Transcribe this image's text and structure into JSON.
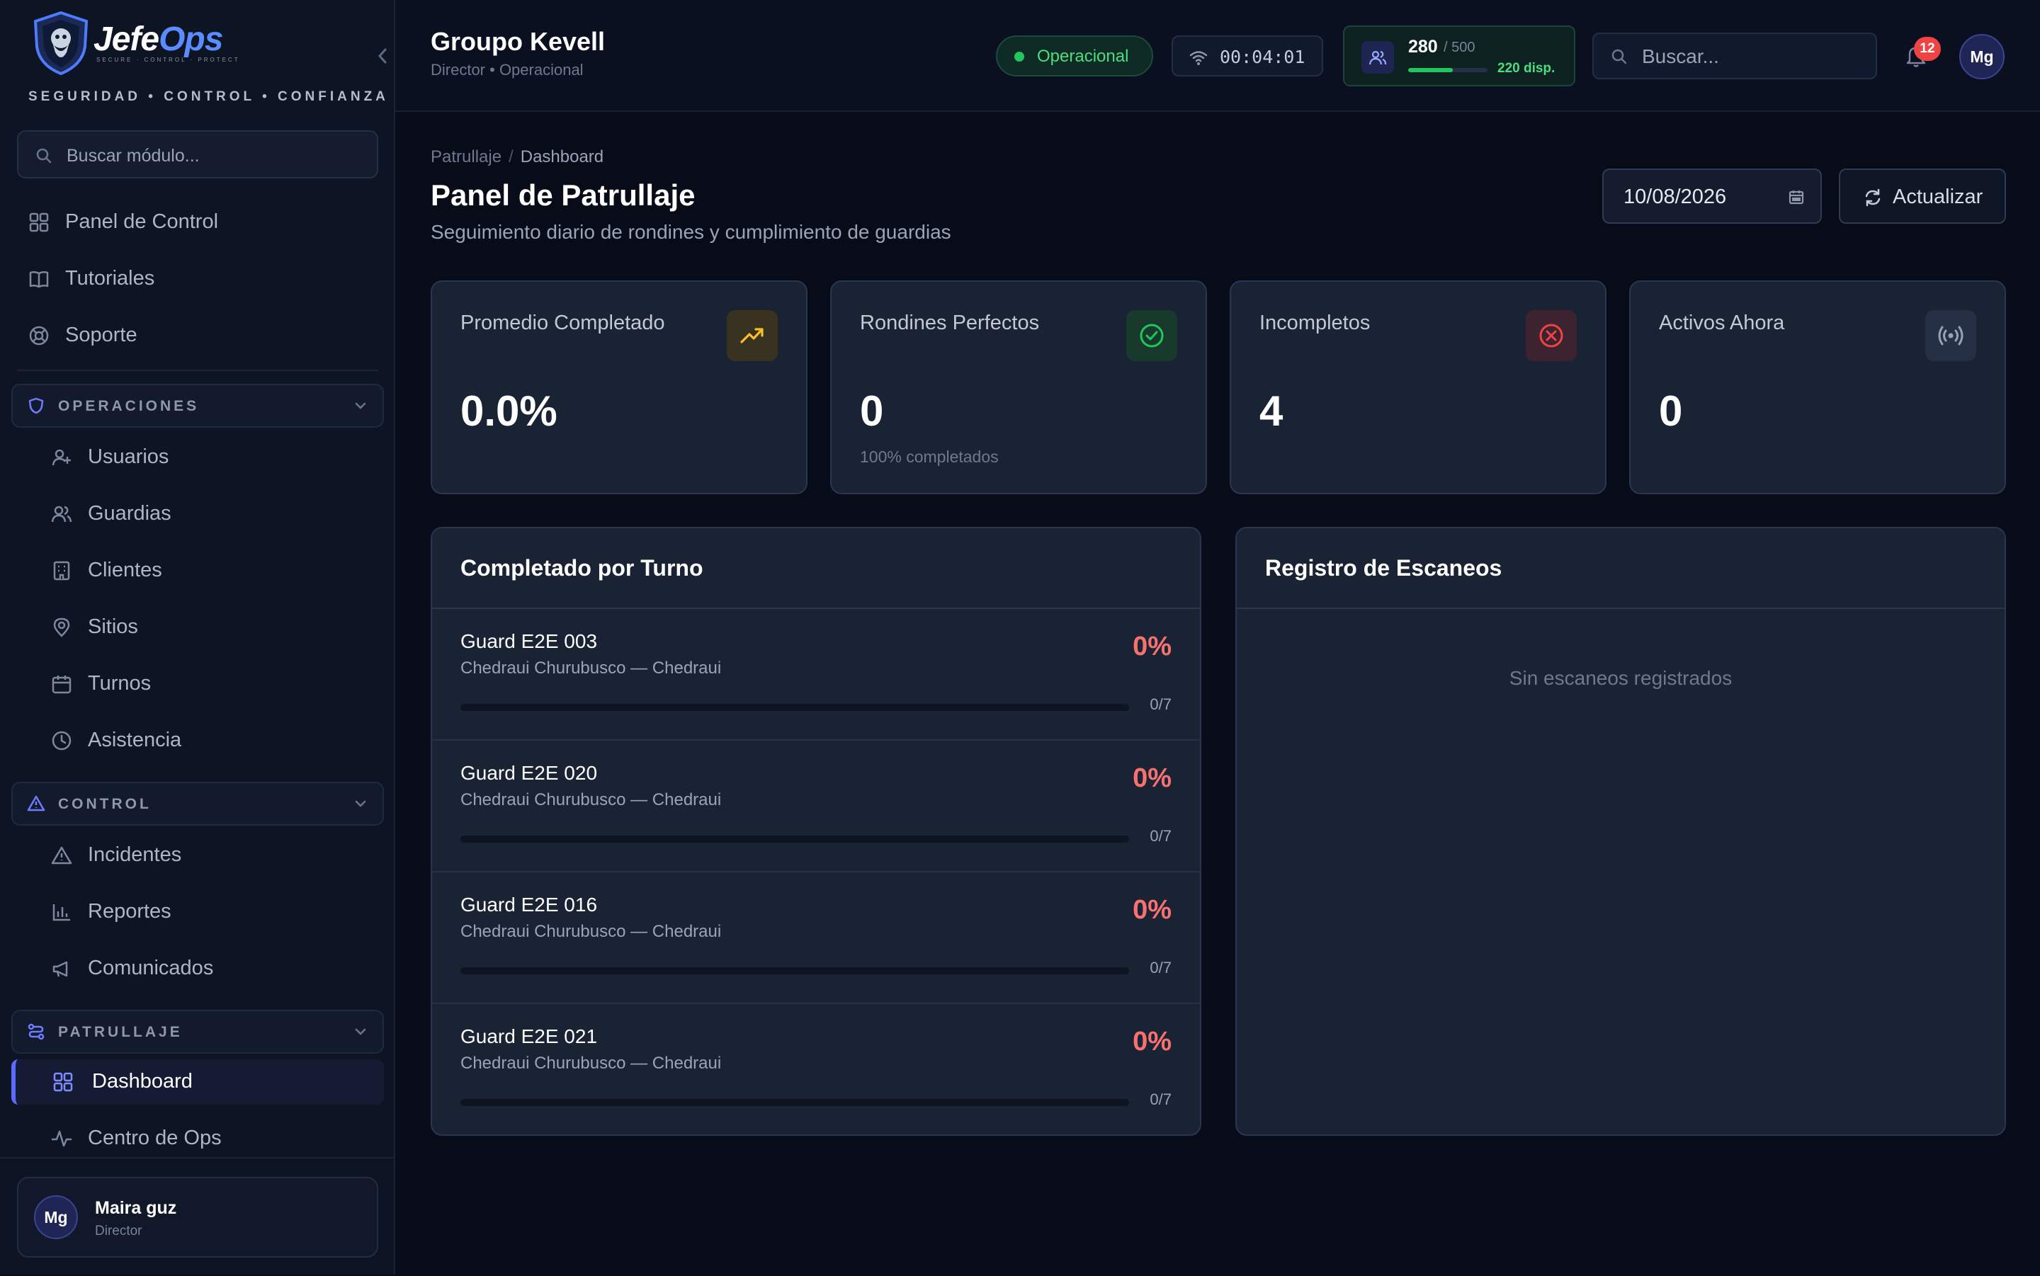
{
  "brand": {
    "name_main": "Jefe",
    "name_accent": "Ops",
    "subtitle": "SECURE · CONTROL · PROTECT",
    "tagline": "SEGURIDAD • CONTROL • CONFIANZA"
  },
  "sidebar": {
    "search_placeholder": "Buscar módulo...",
    "top_items": [
      {
        "label": "Panel de Control",
        "icon": "dashboard-icon"
      },
      {
        "label": "Tutoriales",
        "icon": "book-icon"
      },
      {
        "label": "Soporte",
        "icon": "lifebuoy-icon"
      }
    ],
    "sections": [
      {
        "label": "OPERACIONES",
        "icon": "shield-icon",
        "items": [
          {
            "label": "Usuarios",
            "icon": "user-plus-icon"
          },
          {
            "label": "Guardias",
            "icon": "users-icon"
          },
          {
            "label": "Clientes",
            "icon": "building-icon"
          },
          {
            "label": "Sitios",
            "icon": "map-pin-icon"
          },
          {
            "label": "Turnos",
            "icon": "calendar-icon"
          },
          {
            "label": "Asistencia",
            "icon": "clock-icon"
          }
        ]
      },
      {
        "label": "CONTROL",
        "icon": "warning-icon",
        "items": [
          {
            "label": "Incidentes",
            "icon": "warning-icon"
          },
          {
            "label": "Reportes",
            "icon": "bar-chart-icon"
          },
          {
            "label": "Comunicados",
            "icon": "megaphone-icon"
          }
        ]
      },
      {
        "label": "PATRULLAJE",
        "icon": "route-icon",
        "items": [
          {
            "label": "Dashboard",
            "icon": "dashboard-icon",
            "active": true
          },
          {
            "label": "Centro de Ops",
            "icon": "activity-icon"
          }
        ]
      }
    ],
    "user": {
      "initials": "Mg",
      "name": "Maira guz",
      "role": "Director"
    }
  },
  "header": {
    "org_name": "Groupo Kevell",
    "org_sub": "Director • Operacional",
    "status": "Operacional",
    "timer": "00:04:01",
    "capacity": {
      "count": "280",
      "total": "/ 500",
      "available": "220 disp.",
      "fraction": 0.56
    },
    "search_placeholder": "Buscar...",
    "notifications": "12",
    "avatar_initials": "Mg"
  },
  "page": {
    "breadcrumb": [
      "Patrullaje",
      "Dashboard"
    ],
    "title": "Panel de Patrullaje",
    "subtitle": "Seguimiento diario de rondines y cumplimiento de guardias",
    "date": "10/08/2026",
    "refresh_label": "Actualizar"
  },
  "kpis": [
    {
      "label": "Promedio Completado",
      "value": "0.0%",
      "note": "",
      "icon": "trending-up-icon",
      "color": "#fbbf24"
    },
    {
      "label": "Rondines Perfectos",
      "value": "0",
      "note": "100% completados",
      "icon": "check-circle-icon",
      "color": "#22c55e"
    },
    {
      "label": "Incompletos",
      "value": "4",
      "note": "",
      "icon": "x-circle-icon",
      "color": "#ef4444"
    },
    {
      "label": "Activos Ahora",
      "value": "0",
      "note": "",
      "icon": "broadcast-icon",
      "color": "#94a3b8"
    }
  ],
  "shift_panel": {
    "title": "Completado por Turno",
    "guards": [
      {
        "name": "Guard E2E 003",
        "site": "Chedraui Churubusco — Chedraui",
        "percent": "0%",
        "count": "0/7",
        "fraction": 0
      },
      {
        "name": "Guard E2E 020",
        "site": "Chedraui Churubusco — Chedraui",
        "percent": "0%",
        "count": "0/7",
        "fraction": 0
      },
      {
        "name": "Guard E2E 016",
        "site": "Chedraui Churubusco — Chedraui",
        "percent": "0%",
        "count": "0/7",
        "fraction": 0
      },
      {
        "name": "Guard E2E 021",
        "site": "Chedraui Churubusco — Chedraui",
        "percent": "0%",
        "count": "0/7",
        "fraction": 0
      }
    ]
  },
  "scan_panel": {
    "title": "Registro de Escaneos",
    "empty": "Sin escaneos registrados"
  },
  "colors": {
    "accent": "#5b6bff",
    "success": "#22c55e",
    "danger": "#f87171",
    "background": "#070c18"
  }
}
